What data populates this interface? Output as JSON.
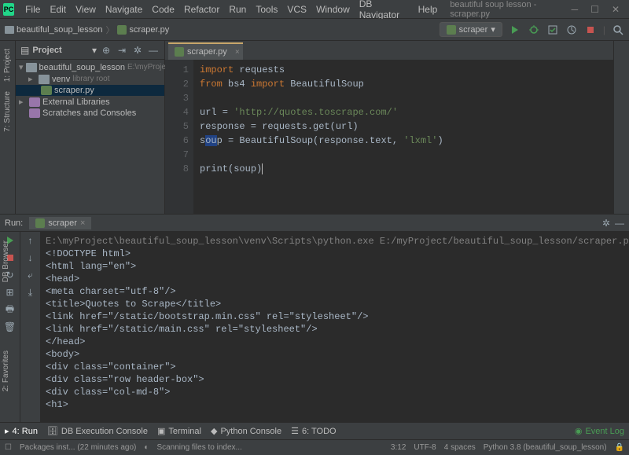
{
  "menubar": [
    "File",
    "Edit",
    "View",
    "Navigate",
    "Code",
    "Refactor",
    "Run",
    "Tools",
    "VCS",
    "Window",
    "DB Navigator",
    "Help"
  ],
  "window_title": "beautiful soup lesson - scraper.py",
  "logo_text": "PC",
  "breadcrumb": {
    "root": "beautiful_soup_lesson",
    "file": "scraper.py"
  },
  "run_config": {
    "label": "scraper",
    "arrow": "▾"
  },
  "project_panel": {
    "title": "Project",
    "arrow": "▾",
    "tree": {
      "root": "beautiful_soup_lesson",
      "root_note": "E:\\myProje...",
      "venv": "venv",
      "venv_note": "library root",
      "file": "scraper.py",
      "ext_lib": "External Libraries",
      "scratch": "Scratches and Consoles"
    }
  },
  "left_tabs": {
    "project": "1: Project",
    "structure": "7: Structure",
    "dbbrowser": "DB Browser",
    "favorites": "2: Favorites"
  },
  "editor": {
    "tab": "scraper.py",
    "lines": [
      "1",
      "2",
      "3",
      "4",
      "5",
      "6",
      "7",
      "8"
    ],
    "code": {
      "l1_kw": "import",
      "l1_rest": " requests",
      "l2_from": "from",
      "l2_mod": " bs4 ",
      "l2_import": "import",
      "l2_rest": " BeautifulSoup",
      "l4_var": "url = ",
      "l4_str": "'http://quotes.toscrape.com/'",
      "l5": "response = requests.get(url)",
      "l6_pre": "s",
      "l6_sel": "ou",
      "l6_post": "p = BeautifulSoup(response.text, ",
      "l6_str": "'lxml'",
      "l6_end": ")",
      "l8_fn": "print",
      "l8_arg": "(soup)"
    }
  },
  "run_panel": {
    "label": "Run:",
    "tab": "scraper",
    "console": [
      "E:\\myProject\\beautiful_soup_lesson\\venv\\Scripts\\python.exe E:/myProject/beautiful_soup_lesson/scraper.py",
      "<!DOCTYPE html>",
      "<html lang=\"en\">",
      "<head>",
      "<meta charset=\"utf-8\"/>",
      "<title>Quotes to Scrape</title>",
      "<link href=\"/static/bootstrap.min.css\" rel=\"stylesheet\"/>",
      "<link href=\"/static/main.css\" rel=\"stylesheet\"/>",
      "</head>",
      "<body>",
      "<div class=\"container\">",
      "<div class=\"row header-box\">",
      "<div class=\"col-md-8\">",
      "<h1>"
    ]
  },
  "bottom_tabs": {
    "run": "4: Run",
    "db": "DB Execution Console",
    "terminal": "Terminal",
    "pyconsole": "Python Console",
    "todo": "6: TODO",
    "eventlog": "Event Log"
  },
  "statusbar": {
    "pkg": "Packages inst... (22 minutes ago)",
    "scan": "Scanning files to index...",
    "pos": "3:12",
    "encoding": "UTF-8",
    "indent": "4 spaces",
    "python": "Python 3.8 (beautiful_soup_lesson)"
  }
}
